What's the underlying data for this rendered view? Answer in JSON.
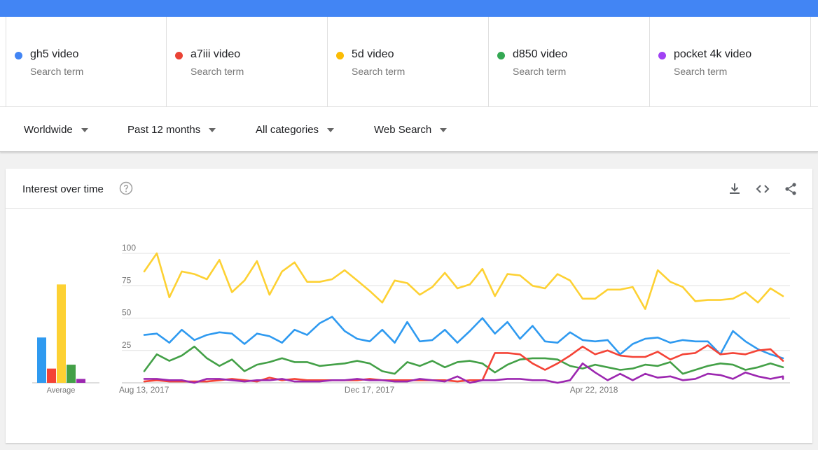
{
  "terms": [
    {
      "name": "gh5 video",
      "sub": "Search term",
      "color": "#4285f4"
    },
    {
      "name": "a7iii video",
      "sub": "Search term",
      "color": "#ea4335"
    },
    {
      "name": "5d video",
      "sub": "Search term",
      "color": "#fbbc04"
    },
    {
      "name": "d850 video",
      "sub": "Search term",
      "color": "#34a853"
    },
    {
      "name": "pocket 4k video",
      "sub": "Search term",
      "color": "#a142f4"
    }
  ],
  "filters": {
    "region": "Worldwide",
    "time": "Past 12 months",
    "category": "All categories",
    "search_type": "Web Search"
  },
  "card": {
    "title": "Interest over time",
    "icons": [
      "help-icon",
      "download-icon",
      "embed-icon",
      "share-icon"
    ]
  },
  "chart_data": {
    "type": "line",
    "ylim": [
      0,
      100
    ],
    "yticks": [
      25,
      50,
      75,
      100
    ],
    "tick_labels": [
      "Aug 13, 2017",
      "Dec 17, 2017",
      "Apr 22, 2018"
    ],
    "tick_positions": [
      0,
      18,
      36
    ],
    "average_label": "Average",
    "averages": [
      35,
      11,
      76,
      14,
      3
    ],
    "series": [
      {
        "name": "5d video",
        "color": "#fdd133",
        "values": [
          86,
          100,
          66,
          86,
          84,
          80,
          95,
          70,
          79,
          94,
          68,
          86,
          93,
          78,
          78,
          80,
          87,
          79,
          71,
          62,
          79,
          77,
          68,
          74,
          85,
          73,
          76,
          88,
          67,
          84,
          83,
          75,
          73,
          84,
          79,
          65,
          65,
          72,
          72,
          74,
          57,
          87,
          78,
          74,
          63,
          64,
          64,
          65,
          70,
          62,
          73,
          67
        ]
      },
      {
        "name": "gh5 video",
        "color": "#2f9af0",
        "values": [
          37,
          38,
          31,
          41,
          33,
          37,
          39,
          38,
          30,
          38,
          36,
          31,
          41,
          37,
          46,
          51,
          40,
          34,
          32,
          41,
          31,
          47,
          32,
          33,
          41,
          31,
          40,
          50,
          38,
          47,
          34,
          44,
          32,
          31,
          39,
          33,
          32,
          33,
          22,
          30,
          34,
          35,
          31,
          33,
          32,
          32,
          22,
          40,
          32,
          26,
          22,
          19
        ]
      },
      {
        "name": "d850 video",
        "color": "#43a047",
        "values": [
          9,
          22,
          17,
          21,
          28,
          19,
          13,
          18,
          9,
          14,
          16,
          19,
          16,
          16,
          13,
          14,
          15,
          17,
          15,
          9,
          7,
          16,
          13,
          17,
          12,
          16,
          17,
          15,
          8,
          14,
          18,
          19,
          19,
          18,
          13,
          11,
          14,
          12,
          10,
          11,
          14,
          13,
          16,
          7,
          10,
          13,
          15,
          14,
          10,
          12,
          15,
          12
        ]
      },
      {
        "name": "a7iii video",
        "color": "#f44336",
        "values": [
          1,
          2,
          1,
          1,
          1,
          1,
          2,
          3,
          2,
          1,
          4,
          2,
          3,
          2,
          2,
          2,
          2,
          2,
          3,
          2,
          2,
          2,
          2,
          2,
          2,
          1,
          2,
          2,
          23,
          23,
          22,
          15,
          10,
          15,
          21,
          28,
          22,
          25,
          21,
          20,
          20,
          24,
          18,
          22,
          23,
          29,
          22,
          23,
          22,
          25,
          26,
          17
        ]
      },
      {
        "name": "pocket 4k video",
        "color": "#9c27b0",
        "values": [
          3,
          3,
          2,
          2,
          0,
          3,
          3,
          2,
          1,
          2,
          2,
          3,
          1,
          1,
          1,
          2,
          2,
          3,
          2,
          2,
          1,
          1,
          3,
          2,
          1,
          5,
          0,
          2,
          2,
          3,
          3,
          2,
          2,
          0,
          2,
          15,
          8,
          2,
          7,
          2,
          7,
          4,
          5,
          2,
          3,
          7,
          6,
          3,
          8,
          5,
          3,
          5,
          3
        ]
      }
    ]
  }
}
